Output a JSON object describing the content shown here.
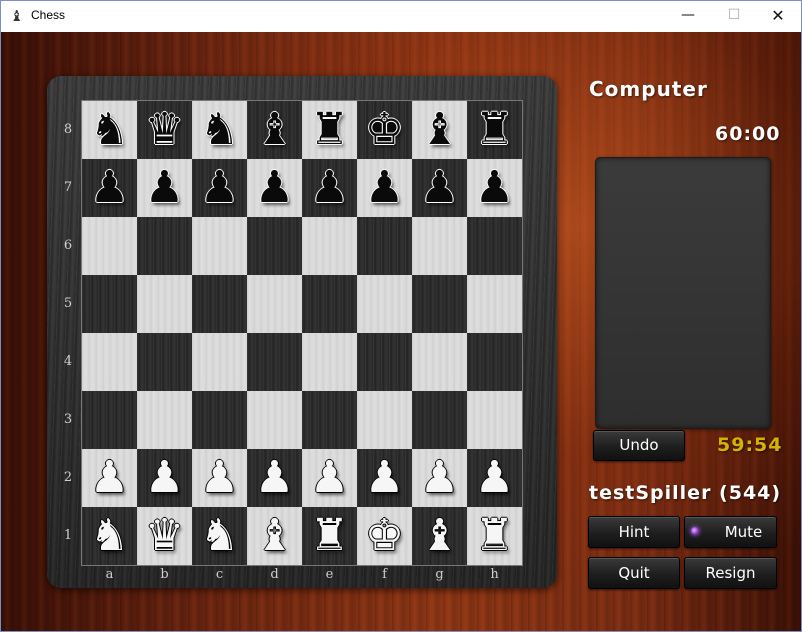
{
  "window": {
    "title": "Chess",
    "app_icon": "chess-pawn-icon",
    "controls": {
      "minimize": "—",
      "maximize": "☐",
      "close": "✕"
    }
  },
  "board": {
    "ranks": [
      "8",
      "7",
      "6",
      "5",
      "4",
      "3",
      "2",
      "1"
    ],
    "files": [
      "a",
      "b",
      "c",
      "d",
      "e",
      "f",
      "g",
      "h"
    ],
    "rows": [
      [
        {
          "c": "b",
          "g": "♞"
        },
        {
          "c": "b",
          "g": "♛"
        },
        {
          "c": "b",
          "g": "♞"
        },
        {
          "c": "b",
          "g": "♝"
        },
        {
          "c": "b",
          "g": "♜"
        },
        {
          "c": "b",
          "g": "♚"
        },
        {
          "c": "b",
          "g": "♝"
        },
        {
          "c": "b",
          "g": "♜"
        }
      ],
      [
        {
          "c": "b",
          "g": "♟"
        },
        {
          "c": "b",
          "g": "♟"
        },
        {
          "c": "b",
          "g": "♟"
        },
        {
          "c": "b",
          "g": "♟"
        },
        {
          "c": "b",
          "g": "♟"
        },
        {
          "c": "b",
          "g": "♟"
        },
        {
          "c": "b",
          "g": "♟"
        },
        {
          "c": "b",
          "g": "♟"
        }
      ],
      [
        null,
        null,
        null,
        null,
        null,
        null,
        null,
        null
      ],
      [
        null,
        null,
        null,
        null,
        null,
        null,
        null,
        null
      ],
      [
        null,
        null,
        null,
        null,
        null,
        null,
        null,
        null
      ],
      [
        null,
        null,
        null,
        null,
        null,
        null,
        null,
        null
      ],
      [
        {
          "c": "w",
          "g": "♟"
        },
        {
          "c": "w",
          "g": "♟"
        },
        {
          "c": "w",
          "g": "♟"
        },
        {
          "c": "w",
          "g": "♟"
        },
        {
          "c": "w",
          "g": "♟"
        },
        {
          "c": "w",
          "g": "♟"
        },
        {
          "c": "w",
          "g": "♟"
        },
        {
          "c": "w",
          "g": "♟"
        }
      ],
      [
        {
          "c": "w",
          "g": "♞"
        },
        {
          "c": "w",
          "g": "♛"
        },
        {
          "c": "w",
          "g": "♞"
        },
        {
          "c": "w",
          "g": "♝"
        },
        {
          "c": "w",
          "g": "♜"
        },
        {
          "c": "w",
          "g": "♚"
        },
        {
          "c": "w",
          "g": "♝"
        },
        {
          "c": "w",
          "g": "♜"
        }
      ]
    ]
  },
  "opponent": {
    "name": "Computer",
    "clock": "60:00"
  },
  "player": {
    "name": "testSpiller (544)",
    "clock": "59:54"
  },
  "buttons": {
    "undo": "Undo",
    "hint": "Hint",
    "mute": "Mute",
    "quit": "Quit",
    "resign": "Resign"
  },
  "colors": {
    "player_clock": "#d4b300",
    "mute_radio": "#8a2fc7"
  }
}
